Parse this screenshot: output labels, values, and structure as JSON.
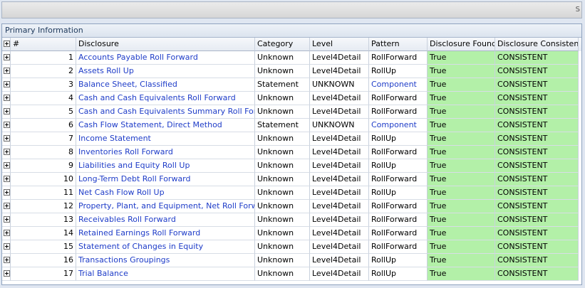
{
  "topbar": {
    "edge_text": "S"
  },
  "panel": {
    "title": "Primary Information"
  },
  "columns": {
    "num": "#",
    "disclosure": "Disclosure",
    "category": "Category",
    "level": "Level",
    "pattern": "Pattern",
    "found": "Disclosure Found",
    "consistent": "Disclosure Consistent"
  },
  "colors": {
    "link": "#1e3cc8",
    "consistent_bg": "#b3f0a8"
  },
  "rows": [
    {
      "num": "1",
      "disclosure": "Accounts Payable Roll Forward",
      "category": "Unknown",
      "level": "Level4Detail",
      "pattern": "RollForward",
      "found": "True",
      "consistent": "CONSISTENT"
    },
    {
      "num": "2",
      "disclosure": "Assets Roll Up",
      "category": "Unknown",
      "level": "Level4Detail",
      "pattern": "RollUp",
      "found": "True",
      "consistent": "CONSISTENT"
    },
    {
      "num": "3",
      "disclosure": "Balance Sheet, Classified",
      "category": "Statement",
      "level": "UNKNOWN",
      "pattern": "Component",
      "found": "True",
      "consistent": "CONSISTENT"
    },
    {
      "num": "4",
      "disclosure": "Cash and Cash Equivalents Roll Forward",
      "category": "Unknown",
      "level": "Level4Detail",
      "pattern": "RollForward",
      "found": "True",
      "consistent": "CONSISTENT"
    },
    {
      "num": "5",
      "disclosure": "Cash and Cash Equivalents Summary Roll Forward",
      "category": "Unknown",
      "level": "Level4Detail",
      "pattern": "RollForward",
      "found": "True",
      "consistent": "CONSISTENT"
    },
    {
      "num": "6",
      "disclosure": "Cash Flow Statement, Direct Method",
      "category": "Statement",
      "level": "UNKNOWN",
      "pattern": "Component",
      "found": "True",
      "consistent": "CONSISTENT"
    },
    {
      "num": "7",
      "disclosure": "Income Statement",
      "category": "Unknown",
      "level": "Level4Detail",
      "pattern": "RollUp",
      "found": "True",
      "consistent": "CONSISTENT"
    },
    {
      "num": "8",
      "disclosure": "Inventories Roll Forward",
      "category": "Unknown",
      "level": "Level4Detail",
      "pattern": "RollForward",
      "found": "True",
      "consistent": "CONSISTENT"
    },
    {
      "num": "9",
      "disclosure": "Liabilities and Equity Roll Up",
      "category": "Unknown",
      "level": "Level4Detail",
      "pattern": "RollUp",
      "found": "True",
      "consistent": "CONSISTENT"
    },
    {
      "num": "10",
      "disclosure": "Long-Term Debt Roll Forward",
      "category": "Unknown",
      "level": "Level4Detail",
      "pattern": "RollForward",
      "found": "True",
      "consistent": "CONSISTENT"
    },
    {
      "num": "11",
      "disclosure": "Net Cash Flow Roll Up",
      "category": "Unknown",
      "level": "Level4Detail",
      "pattern": "RollUp",
      "found": "True",
      "consistent": "CONSISTENT"
    },
    {
      "num": "12",
      "disclosure": "Property, Plant, and Equipment, Net Roll Forward",
      "category": "Unknown",
      "level": "Level4Detail",
      "pattern": "RollForward",
      "found": "True",
      "consistent": "CONSISTENT"
    },
    {
      "num": "13",
      "disclosure": "Receivables Roll Forward",
      "category": "Unknown",
      "level": "Level4Detail",
      "pattern": "RollForward",
      "found": "True",
      "consistent": "CONSISTENT"
    },
    {
      "num": "14",
      "disclosure": "Retained Earnings Roll Forward",
      "category": "Unknown",
      "level": "Level4Detail",
      "pattern": "RollForward",
      "found": "True",
      "consistent": "CONSISTENT"
    },
    {
      "num": "15",
      "disclosure": "Statement of Changes in Equity",
      "category": "Unknown",
      "level": "Level4Detail",
      "pattern": "RollForward",
      "found": "True",
      "consistent": "CONSISTENT"
    },
    {
      "num": "16",
      "disclosure": "Transactions Groupings",
      "category": "Unknown",
      "level": "Level4Detail",
      "pattern": "RollUp",
      "found": "True",
      "consistent": "CONSISTENT"
    },
    {
      "num": "17",
      "disclosure": "Trial Balance",
      "category": "Unknown",
      "level": "Level4Detail",
      "pattern": "RollUp",
      "found": "True",
      "consistent": "CONSISTENT"
    }
  ]
}
